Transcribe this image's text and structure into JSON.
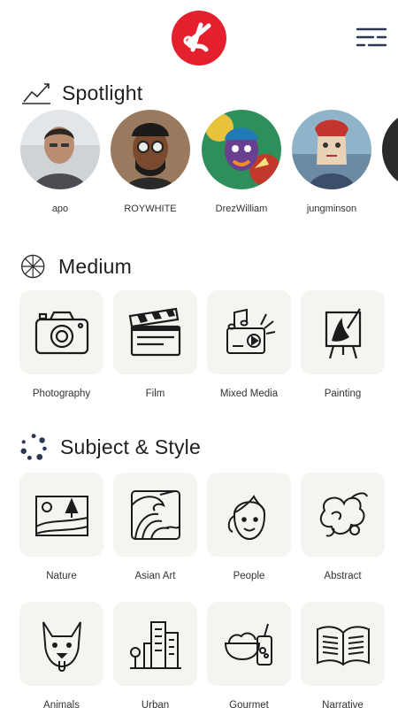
{
  "header": {
    "logo_icon": "k-logo-icon",
    "menu_icon": "filter-menu-icon",
    "brand_color": "#e5202e"
  },
  "spotlight": {
    "title": "Spotlight",
    "creators": [
      {
        "name": "apo"
      },
      {
        "name": "ROYWHITE"
      },
      {
        "name": "DrezWilliam"
      },
      {
        "name": "jungminson"
      }
    ]
  },
  "medium": {
    "title": "Medium",
    "items": [
      {
        "label": "Photography",
        "icon": "camera-icon"
      },
      {
        "label": "Film",
        "icon": "clapperboard-icon"
      },
      {
        "label": "Mixed Media",
        "icon": "mixed-media-icon"
      },
      {
        "label": "Painting",
        "icon": "easel-icon"
      }
    ]
  },
  "subject": {
    "title": "Subject & Style",
    "items": [
      {
        "label": "Nature",
        "icon": "landscape-icon"
      },
      {
        "label": "Asian Art",
        "icon": "wave-icon"
      },
      {
        "label": "People",
        "icon": "face-icon"
      },
      {
        "label": "Abstract",
        "icon": "abstract-icon"
      },
      {
        "label": "Animals",
        "icon": "dog-icon"
      },
      {
        "label": "Urban",
        "icon": "buildings-icon"
      },
      {
        "label": "Gourmet",
        "icon": "food-icon"
      },
      {
        "label": "Narrative",
        "icon": "book-icon"
      }
    ]
  }
}
